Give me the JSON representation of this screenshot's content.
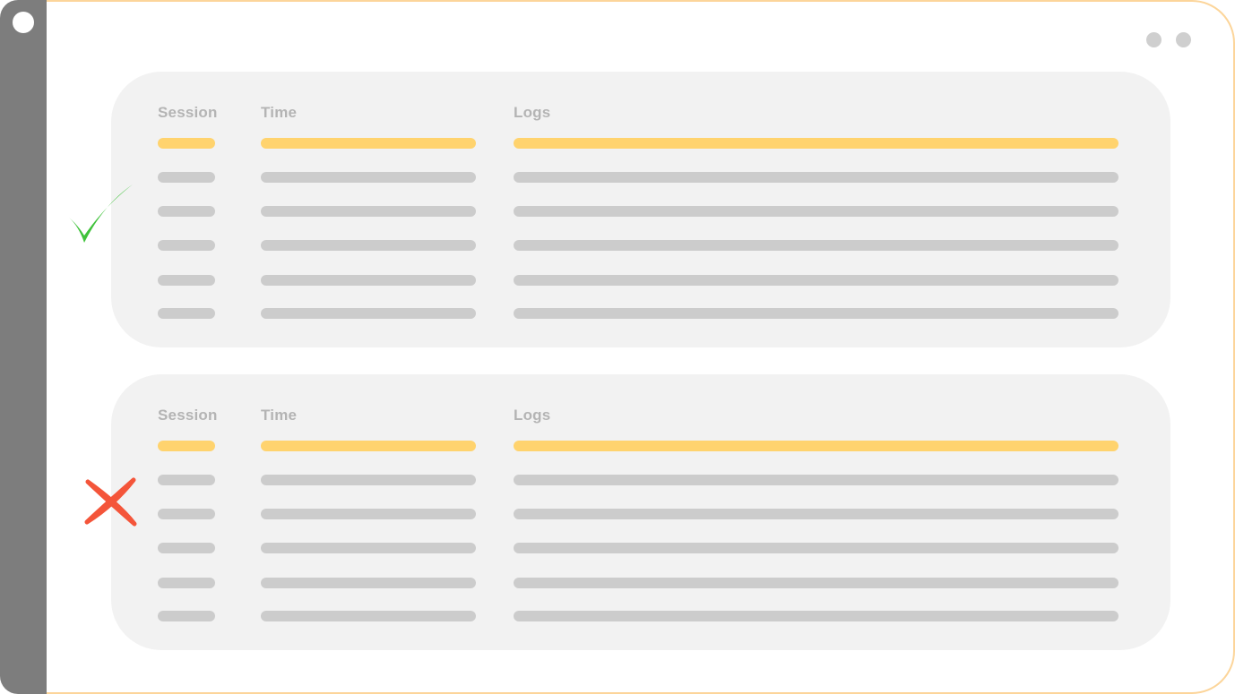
{
  "panels": [
    {
      "status": "valid",
      "status_icon": "checkmark-icon",
      "status_color": "#3fc23a",
      "columns": [
        "Session",
        "Time",
        "Logs"
      ],
      "rows": [
        {
          "highlighted": true
        },
        {
          "highlighted": false
        },
        {
          "highlighted": false
        },
        {
          "highlighted": false
        },
        {
          "highlighted": false
        },
        {
          "highlighted": false
        }
      ]
    },
    {
      "status": "invalid",
      "status_icon": "cross-icon",
      "status_color": "#f4553a",
      "columns": [
        "Session",
        "Time",
        "Logs"
      ],
      "rows": [
        {
          "highlighted": true
        },
        {
          "highlighted": false
        },
        {
          "highlighted": false
        },
        {
          "highlighted": false
        },
        {
          "highlighted": false
        },
        {
          "highlighted": false
        }
      ]
    }
  ],
  "colors": {
    "highlight_bar": "#ffd36e",
    "placeholder_bar": "#cccccc",
    "panel_bg": "#f2f2f2",
    "rail": "#7d7d7d",
    "window_border": "#fcd59a"
  }
}
